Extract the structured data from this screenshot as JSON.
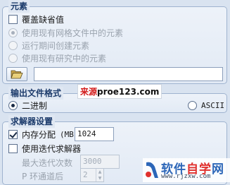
{
  "elements_group": {
    "title": "元素",
    "override_default": {
      "label": "覆盖缺省值",
      "checked": false
    },
    "options": [
      {
        "label": "使用现有网格文件中的元素",
        "selected": true
      },
      {
        "label": "运行期间创建元素",
        "selected": false
      },
      {
        "label": "使用现有研究中的元素",
        "selected": false
      }
    ],
    "file_path": ""
  },
  "output_group": {
    "title": "输出文件格式",
    "binary_label": "二进制",
    "ascii_label": "ASCII",
    "selected": "二进制"
  },
  "solver_group": {
    "title": "求解器设置",
    "memory_label": "内存分配",
    "memory_unit": "(MB)",
    "memory_value": "1024",
    "memory_checked": true,
    "iterative_label": "使用迭代求解器",
    "iterative_checked": false,
    "max_iterations_label": "最大迭代次数",
    "max_iterations_value": "3000",
    "p_loop_label": "P 环通道后",
    "p_loop_value": "2"
  },
  "watermarks": {
    "center_prefix": "来源",
    "center_site": "proe123.com",
    "logo_part1": "软件",
    "logo_part2": "自学",
    "logo_part3": "网",
    "logo_url": "www.rjzxw.com"
  }
}
